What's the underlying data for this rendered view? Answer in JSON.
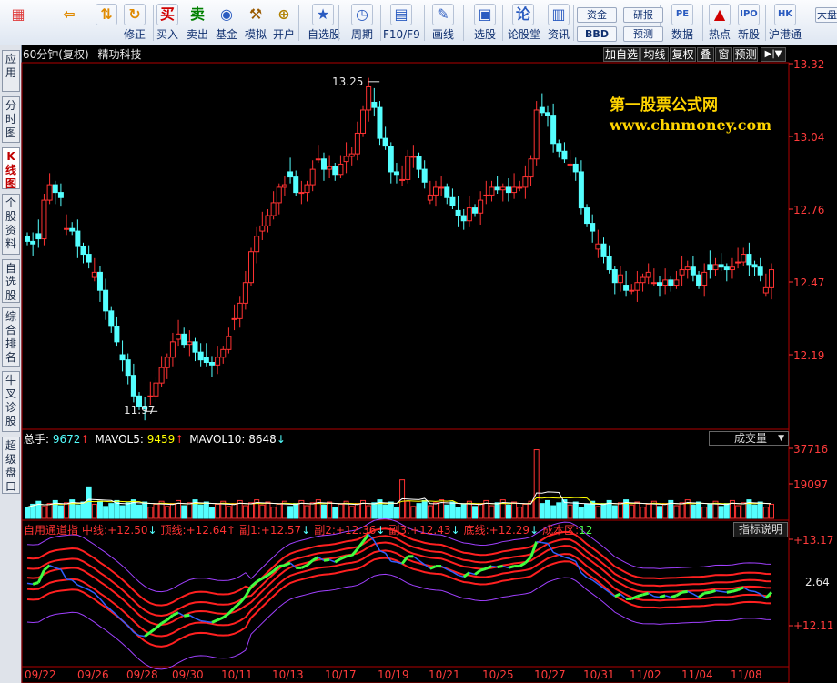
{
  "toolbar": {
    "buttons": [
      {
        "id": "grid-icon",
        "label": "",
        "glyph": "▦",
        "color": "#e04040"
      },
      {
        "id": "back-icon",
        "label": "",
        "glyph": "⇦",
        "color": "#e08a00"
      },
      {
        "id": "up-down-icon",
        "label": "",
        "glyph": "⇅",
        "color": "#e08a00"
      },
      {
        "id": "restore",
        "label": "修正",
        "glyph": "↻",
        "color": "#e08a00"
      },
      {
        "id": "buy",
        "label": "买入",
        "glyph": "买",
        "color": "#d00000"
      },
      {
        "id": "sell",
        "label": "卖出",
        "glyph": "卖",
        "color": "#008000"
      },
      {
        "id": "fund",
        "label": "基金",
        "glyph": "◉",
        "color": "#2a5bc0"
      },
      {
        "id": "simulate",
        "label": "模拟",
        "glyph": "⚒",
        "color": "#9a5a00"
      },
      {
        "id": "open-account",
        "label": "开户",
        "glyph": "⊕",
        "color": "#b08000"
      },
      {
        "id": "watchlist",
        "label": "自选股",
        "glyph": "★",
        "color": "#2a5bc0"
      },
      {
        "id": "period",
        "label": "周期",
        "glyph": "◷",
        "color": "#2a5bc0"
      },
      {
        "id": "f10",
        "label": "F10/F9",
        "glyph": "▤",
        "color": "#2a5bc0"
      },
      {
        "id": "draw",
        "label": "画线",
        "glyph": "✎",
        "color": "#2a5bc0"
      },
      {
        "id": "select-stock",
        "label": "选股",
        "glyph": "▣",
        "color": "#2a5bc0"
      },
      {
        "id": "forum",
        "label": "论股堂",
        "glyph": "论",
        "color": "#2a5bc0"
      },
      {
        "id": "info",
        "label": "资讯",
        "glyph": "▥",
        "color": "#2a5bc0"
      },
      {
        "id": "data",
        "label": "数据",
        "glyph": "PE",
        "color": "#2a5bc0"
      },
      {
        "id": "hot",
        "label": "热点",
        "glyph": "▲",
        "color": "#d00000"
      },
      {
        "id": "new-stock",
        "label": "新股",
        "glyph": "IPO",
        "color": "#2a5bc0"
      },
      {
        "id": "sh-hk",
        "label": "沪港通",
        "glyph": "HK",
        "color": "#2a5bc0"
      }
    ],
    "pills": {
      "funds": "资金",
      "bbd": "BBD",
      "research": "研报",
      "forecast": "预测",
      "big": "大盘"
    }
  },
  "sidebar": {
    "tabs": [
      "应用",
      "分时图",
      "K线图",
      "个股资料",
      "自选股",
      "综合排名",
      "牛叉诊股",
      "超级盘口"
    ]
  },
  "header": {
    "period": "60分钟(复权)",
    "stock": "精功科技",
    "buttons": [
      "加自选",
      "均线",
      "复权",
      "叠",
      "窗",
      "预测"
    ],
    "nav": "▶|▼"
  },
  "watermark": {
    "line1": "第一股票公式网",
    "line2": "www.chnmoney.com"
  },
  "price_axis": {
    "labels": [
      "13.32",
      "13.04",
      "12.76",
      "12.47",
      "12.19"
    ]
  },
  "annotations": {
    "high": "13.25",
    "low": "11.97"
  },
  "volume": {
    "total_label": "总手:",
    "total": "9672",
    "mavol5_label": "MAVOL5:",
    "mavol5": "9459",
    "mavol10_label": "MAVOL10:",
    "mavol10": "8648",
    "select": "成交量",
    "axis": [
      "37716",
      "19097"
    ]
  },
  "indicator": {
    "name": "自用通道指",
    "fields": [
      {
        "label": "中线:",
        "value": "+12.50",
        "arrow": "↓"
      },
      {
        "label": "顶线:",
        "value": "+12.64",
        "arrow": "↑"
      },
      {
        "label": "副1:",
        "value": "+12.57",
        "arrow": "↓"
      },
      {
        "label": "副2:",
        "value": "+12.36",
        "arrow": "↓"
      },
      {
        "label": "副3:",
        "value": "+12.43",
        "arrow": "↓"
      },
      {
        "label": "底线:",
        "value": "+12.29",
        "arrow": "↓"
      },
      {
        "label": "成本区:",
        "value": "12",
        "arrow": ""
      }
    ],
    "button": "指标说明",
    "axis": [
      "+13.17",
      "2.64",
      "+12.11"
    ]
  },
  "x_axis": {
    "labels": [
      "09/22",
      "09/26",
      "09/28",
      "09/30",
      "10/11",
      "10/13",
      "10/17",
      "10/19",
      "10/21",
      "10/25",
      "10/27",
      "10/31",
      "11/02",
      "11/04",
      "11/08"
    ]
  },
  "colors": {
    "up": "#ff3232",
    "down": "#54ffff",
    "white": "#ffffff",
    "yellow": "#ffff00",
    "magenta": "#ff40ff"
  },
  "chart_data": {
    "type": "candlestick",
    "title": "精功科技 60分钟(复权)",
    "y_axis": {
      "labels": [
        13.32,
        13.04,
        12.76,
        12.47,
        12.19
      ]
    },
    "x_labels": [
      "09/22",
      "09/26",
      "09/28",
      "09/30",
      "10/11",
      "10/13",
      "10/17",
      "10/19",
      "10/21",
      "10/25",
      "10/27",
      "10/31",
      "11/02",
      "11/04",
      "11/08"
    ],
    "close": [
      12.63,
      12.62,
      12.64,
      12.79,
      12.85,
      12.82,
      12.8,
      12.68,
      12.67,
      12.61,
      12.58,
      12.55,
      12.51,
      12.44,
      12.36,
      12.3,
      12.24,
      12.17,
      12.11,
      12.03,
      11.99,
      11.98,
      12.03,
      12.08,
      12.14,
      12.18,
      12.24,
      12.27,
      12.23,
      12.24,
      12.2,
      12.17,
      12.16,
      12.15,
      12.18,
      12.21,
      12.26,
      12.33,
      12.39,
      12.47,
      12.59,
      12.65,
      12.69,
      12.73,
      12.78,
      12.84,
      12.85,
      12.88,
      12.82,
      12.82,
      12.85,
      12.91,
      12.95,
      12.91,
      12.92,
      12.89,
      12.93,
      12.96,
      12.97,
      13.05,
      13.14,
      13.23,
      13.15,
      13.03,
      13.0,
      12.9,
      12.89,
      12.87,
      12.96,
      12.96,
      12.91,
      12.86,
      12.81,
      12.84,
      12.84,
      12.8,
      12.77,
      12.73,
      12.71,
      12.76,
      12.74,
      12.79,
      12.81,
      12.84,
      12.83,
      12.84,
      12.82,
      12.84,
      12.84,
      12.88,
      12.95,
      13.14,
      13.13,
      13.12,
      13.01,
      12.98,
      12.95,
      12.93,
      12.9,
      12.76,
      12.7,
      12.67,
      12.62,
      12.57,
      12.52,
      12.47,
      12.5,
      12.44,
      12.44,
      12.47,
      12.49,
      12.51,
      12.47,
      12.46,
      12.48,
      12.46,
      12.48,
      12.52,
      12.53,
      12.5,
      12.46,
      12.51,
      12.52,
      12.54,
      12.53,
      12.52,
      12.53,
      12.55,
      12.58,
      12.54,
      12.53,
      12.5,
      12.45,
      12.52
    ],
    "volume_axis": [
      37716,
      19097
    ],
    "mavol5": 9459,
    "mavol10": 8648,
    "total_volume": 9672,
    "indicator_values": {
      "中线": 12.5,
      "顶线": 12.64,
      "副1": 12.57,
      "副2": 12.36,
      "副3": 12.43,
      "底线": 12.29,
      "成本区": 12
    },
    "indicator_axis": [
      13.17,
      12.64,
      12.11
    ],
    "annotations": {
      "high": 13.25,
      "low": 11.97
    },
    "grid": false
  }
}
